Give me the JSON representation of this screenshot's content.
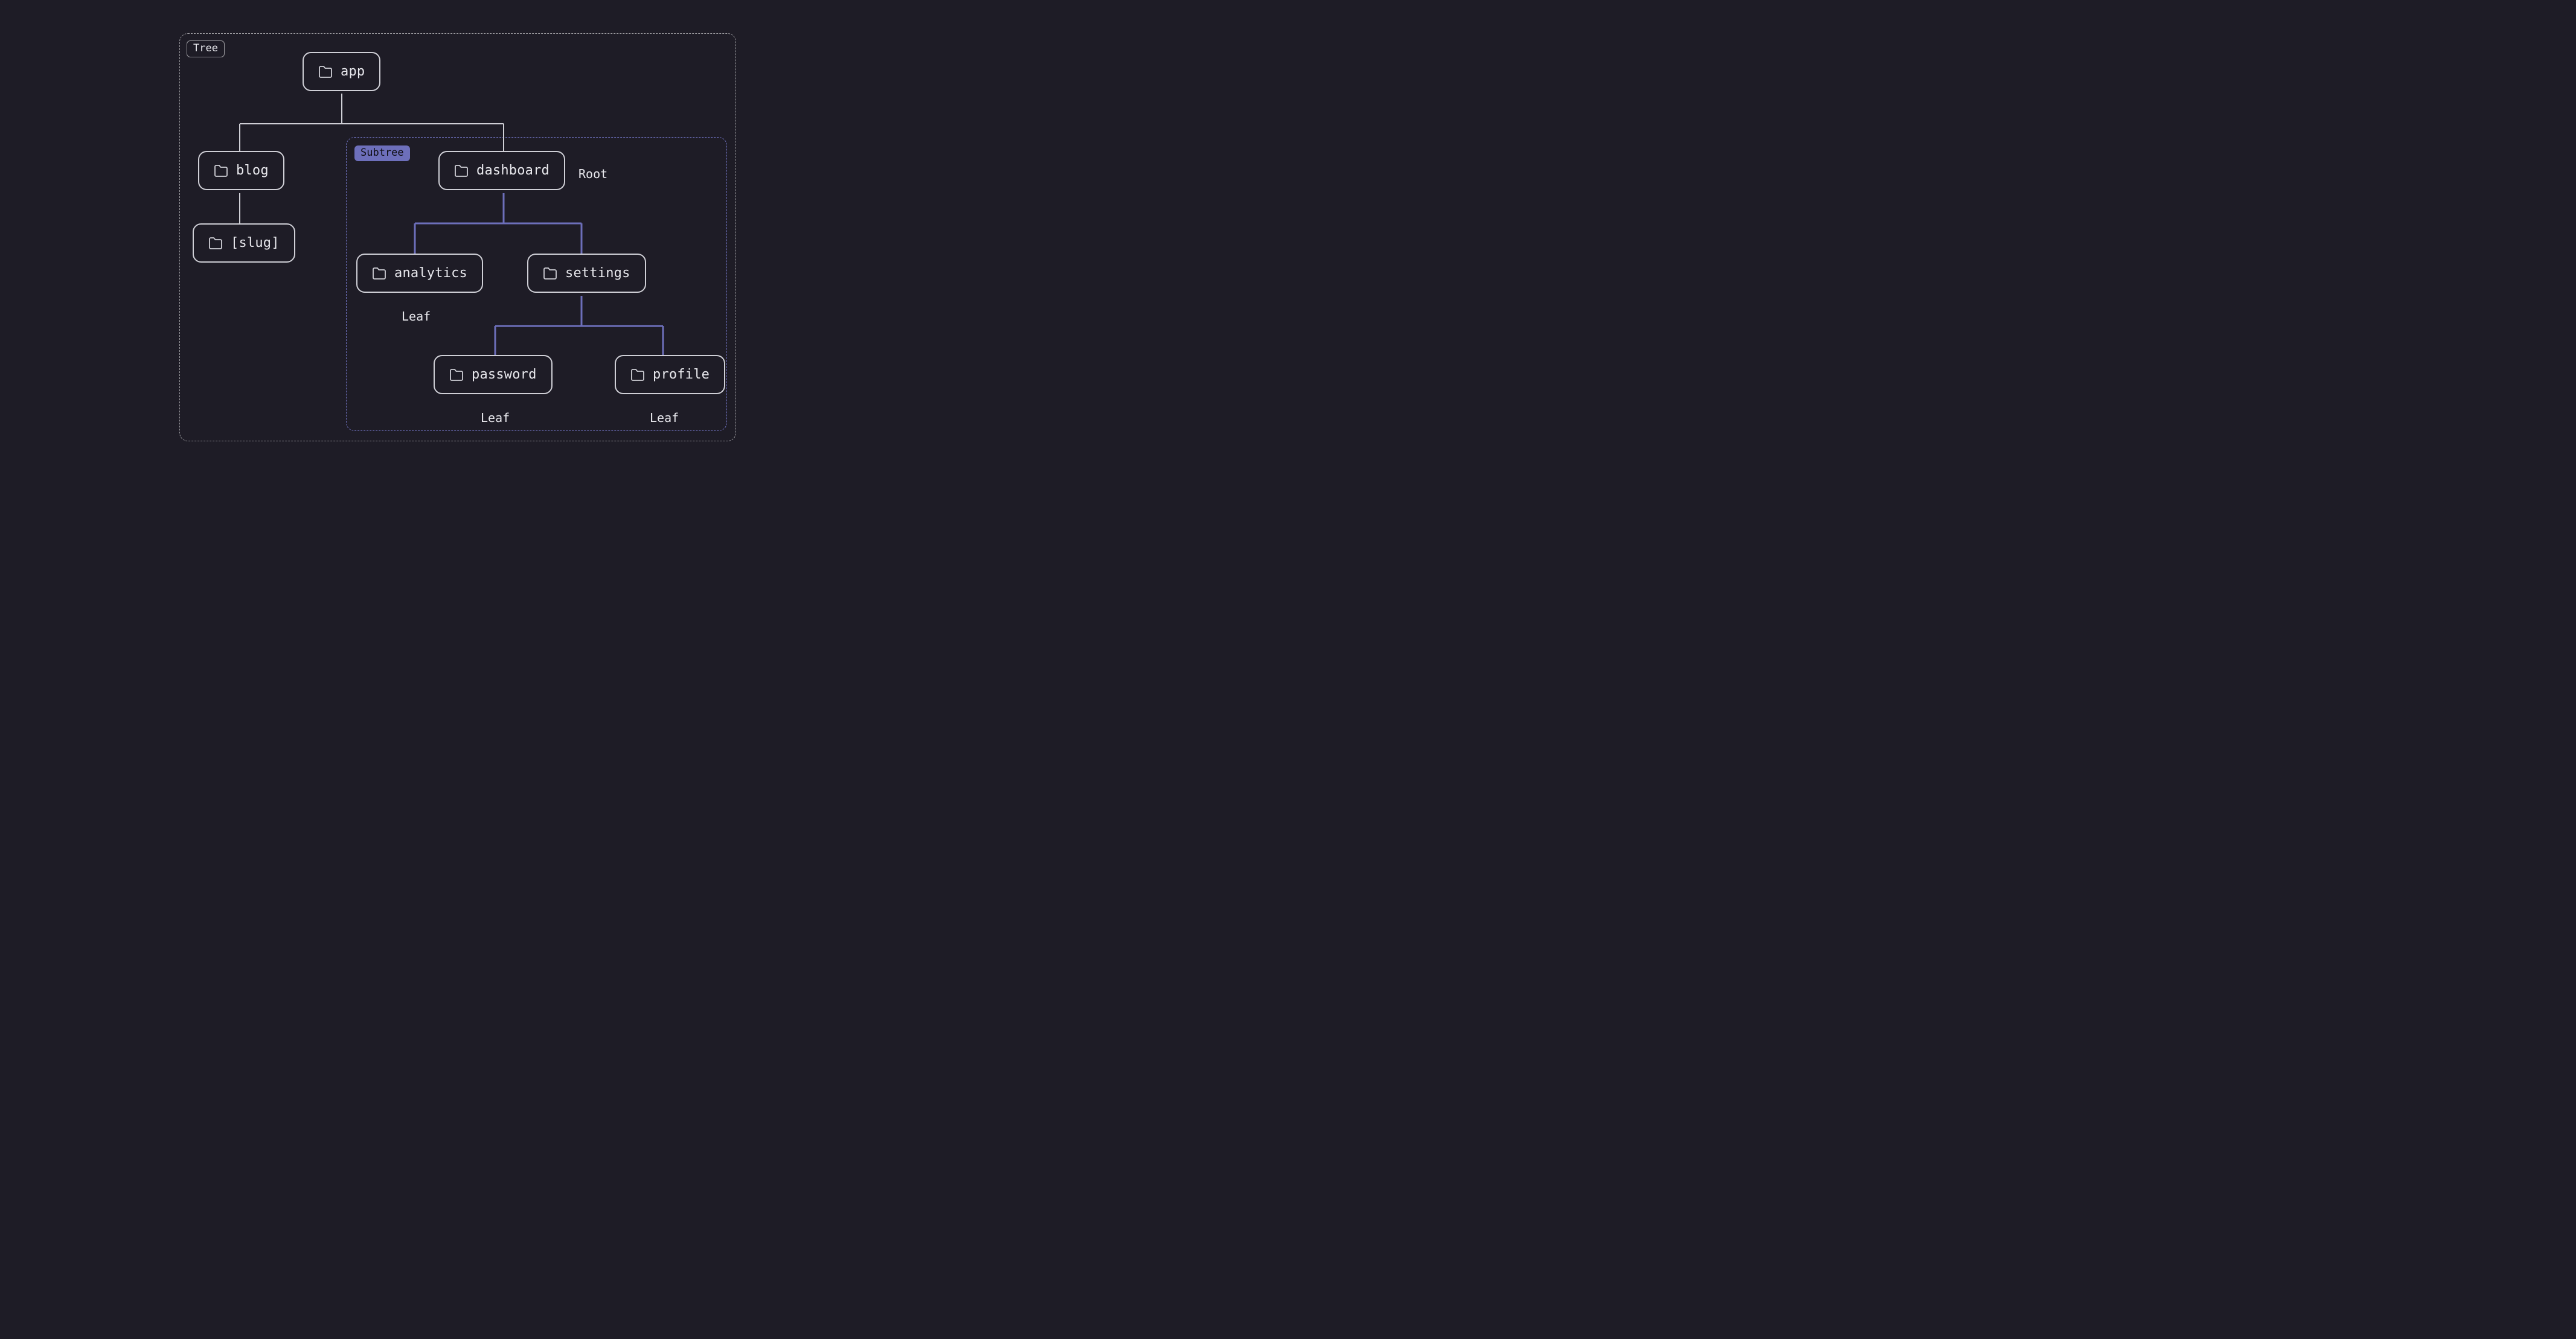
{
  "frames": {
    "tree_label": "Tree",
    "subtree_label": "Subtree"
  },
  "nodes": {
    "app": "app",
    "blog": "blog",
    "slug": "[slug]",
    "dashboard": "dashboard",
    "analytics": "analytics",
    "settings": "settings",
    "password": "password",
    "profile": "profile"
  },
  "annotations": {
    "root": "Root",
    "leaf_analytics": "Leaf",
    "leaf_password": "Leaf",
    "leaf_profile": "Leaf"
  },
  "colors": {
    "background": "#1e1c26",
    "node_border": "#cfcfd6",
    "tree_dash": "rgba(255,255,255,0.55)",
    "subtree_accent": "#6d6fbb",
    "text": "#e8e8ed"
  },
  "structure": {
    "root": "app",
    "children": {
      "app": [
        "blog",
        "dashboard"
      ],
      "blog": [
        "[slug]"
      ],
      "dashboard": [
        "analytics",
        "settings"
      ],
      "settings": [
        "password",
        "profile"
      ]
    },
    "subtree_root": "dashboard",
    "leaves": [
      "[slug]",
      "analytics",
      "password",
      "profile"
    ]
  }
}
